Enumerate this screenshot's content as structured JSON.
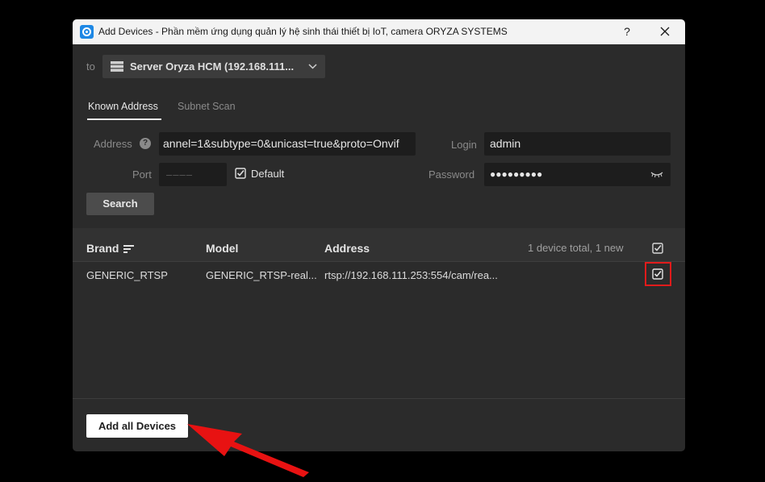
{
  "window": {
    "title": "Add Devices - Phần mềm ứng dụng quản lý hệ sinh thái thiết bị IoT, camera ORYZA SYSTEMS",
    "help": "?"
  },
  "target": {
    "to_label": "to",
    "server": "Server Oryza HCM (192.168.111...",
    "server_icon": "server-icon"
  },
  "tabs": [
    {
      "label": "Known Address",
      "active": true
    },
    {
      "label": "Subnet Scan",
      "active": false
    }
  ],
  "form": {
    "address_label": "Address",
    "address_value": "annel=1&subtype=0&unicast=true&proto=Onvif",
    "port_label": "Port",
    "port_placeholder": "––––",
    "default_label": "Default",
    "default_checked": true,
    "login_label": "Login",
    "login_value": "admin",
    "password_label": "Password",
    "password_value": "●●●●●●●●●",
    "search_label": "Search"
  },
  "table": {
    "columns": [
      "Brand",
      "Model",
      "Address"
    ],
    "summary": "1 device total, 1 new",
    "rows": [
      {
        "brand": "GENERIC_RTSP",
        "model": "GENERIC_RTSP-real...",
        "address": "rtsp://192.168.111.253:554/cam/rea...",
        "checked": true
      }
    ]
  },
  "footer": {
    "add_all_label": "Add all Devices"
  },
  "colors": {
    "accent_highlight": "#e21b1b",
    "app_icon": "#1e88e5"
  }
}
